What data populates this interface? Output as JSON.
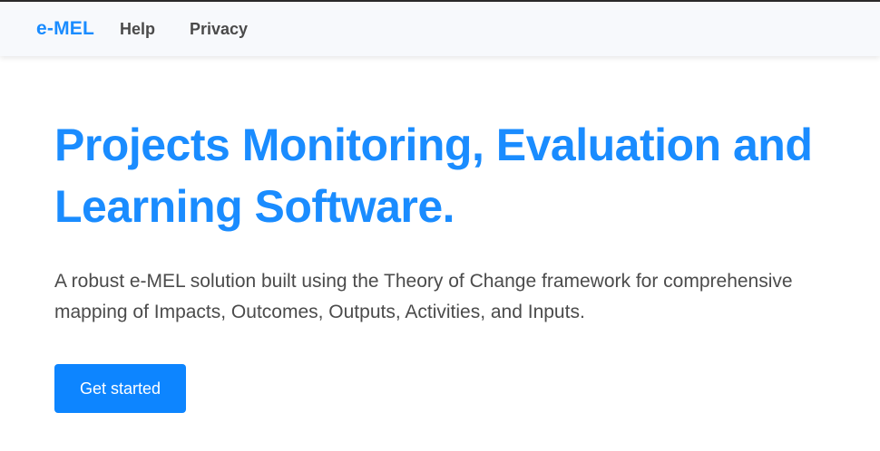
{
  "navbar": {
    "brand": "e-MEL",
    "links": [
      {
        "label": "Help"
      },
      {
        "label": "Privacy"
      }
    ]
  },
  "hero": {
    "title": "Projects Monitoring, Evaluation and Learning Software.",
    "lead": "A robust e-MEL solution built using the Theory of Change framework for comprehensive mapping of Impacts, Outcomes, Outputs, Activities, and Inputs.",
    "cta_label": "Get started"
  },
  "colors": {
    "brand": "#1a8cff",
    "button": "#0d85ff",
    "navbar_bg": "#f7f9fc",
    "text_muted": "#4b4b4b"
  }
}
